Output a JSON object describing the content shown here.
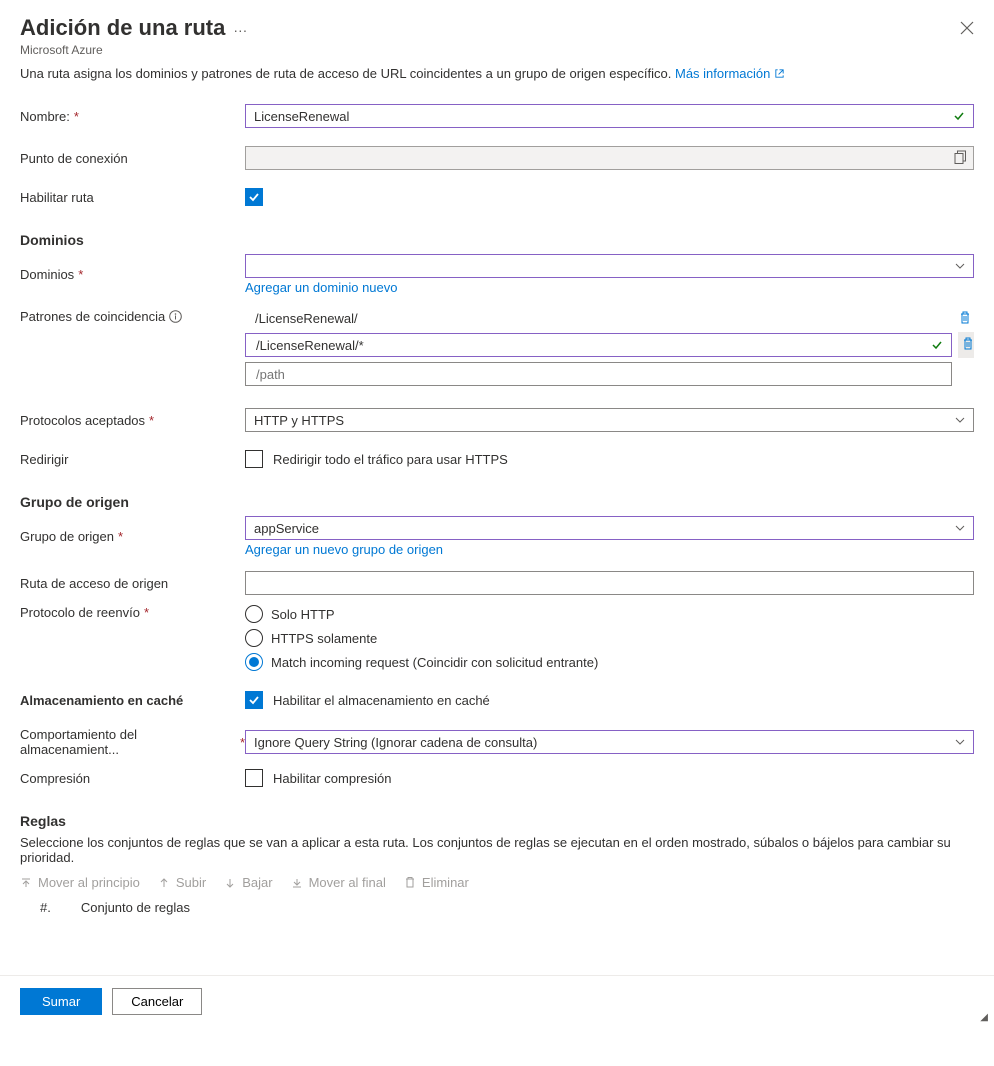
{
  "header": {
    "title": "Adición de una ruta",
    "subtitle": "Microsoft Azure"
  },
  "intro": {
    "text": "Una ruta asigna los dominios y patrones de ruta de acceso de URL coincidentes a un grupo de origen específico. ",
    "link": "Más información"
  },
  "fields": {
    "name_label": "Nombre:",
    "name_value": "LicenseRenewal",
    "endpoint_label": "Punto de conexión",
    "enable_route_label": "Habilitar ruta"
  },
  "domains": {
    "section": "Dominios",
    "label": "Dominios",
    "add_link": "Agregar un dominio nuevo",
    "patterns_label": "Patrones de coincidencia",
    "pattern_readonly": "/LicenseRenewal/",
    "pattern_editable": "/LicenseRenewal/*",
    "pattern_placeholder": "/path",
    "protocols_label": "Protocolos aceptados",
    "protocols_value": "HTTP y HTTPS",
    "redirect_label": "Redirigir",
    "redirect_checkbox": "Redirigir todo el tráfico para usar HTTPS"
  },
  "origin": {
    "section": "Grupo de origen",
    "group_label": "Grupo de origen",
    "group_value": "appService",
    "add_link": "Agregar un nuevo grupo de origen",
    "path_label": "Ruta de acceso de origen",
    "forward_label": "Protocolo de reenvío",
    "radio1": "Solo HTTP",
    "radio2": "HTTPS solamente",
    "radio3": "Match incoming request (Coincidir con solicitud entrante)"
  },
  "cache": {
    "label": "Almacenamiento en caché",
    "enable": "Habilitar el almacenamiento en caché",
    "behavior_label": "Comportamiento del almacenamient...",
    "behavior_value": "Ignore Query String (Ignorar cadena de consulta)",
    "compression_label": "Compresión",
    "compression_enable": "Habilitar compresión"
  },
  "rules": {
    "section": "Reglas",
    "desc": "Seleccione los conjuntos de reglas que se van a aplicar a esta ruta. Los conjuntos de reglas se ejecutan en el orden mostrado, súbalos o bájelos para cambiar su prioridad.",
    "toolbar": {
      "move_top": "Mover al principio",
      "up": "Subir",
      "down": "Bajar",
      "move_end": "Mover al final",
      "delete": "Eliminar"
    },
    "col_num": "#.",
    "col_set": "Conjunto de reglas"
  },
  "footer": {
    "add": "Sumar",
    "cancel": "Cancelar"
  }
}
